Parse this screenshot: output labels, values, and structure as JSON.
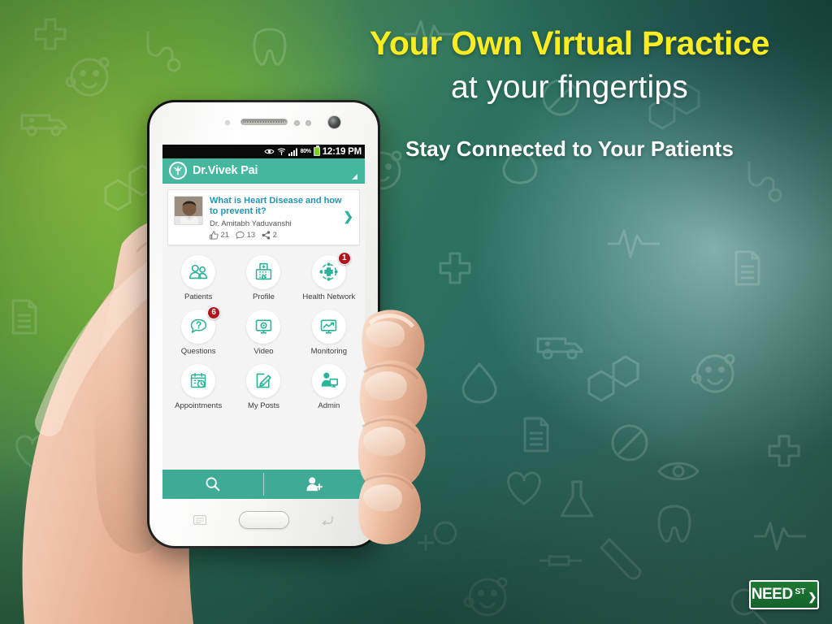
{
  "hero": {
    "line1": "Your Own Virtual Practice",
    "line2": "at your fingertips",
    "line3": "Stay Connected to Your Patients",
    "accent_yellow": "#fbed21",
    "accent_white": "#ffffff"
  },
  "phone": {
    "statusbar": {
      "eye_icon": "eye-icon",
      "wifi_icon": "wifi-icon",
      "signal_icon": "signal-bars-icon",
      "battery_percent": "80%",
      "battery_icon": "battery-icon",
      "time": "12:19 PM"
    },
    "appbar": {
      "logo_icon": "caduceus-logo-icon",
      "title": "Dr.Vivek Pai",
      "caret_icon": "dropdown-caret-icon",
      "color": "#45b79f"
    },
    "feed_card": {
      "thumb_icon": "doctor-avatar",
      "title": "What is Heart Disease and how to prevent it?",
      "author": "Dr. Amitabh Yaduvanshi",
      "likes": "21",
      "comments": "13",
      "shares": "2",
      "like_icon": "thumbs-up-icon",
      "comment_icon": "comment-bubble-icon",
      "share_icon": "share-icon",
      "chevron_icon": "chevron-right-icon",
      "title_color": "#2196b3"
    },
    "grid": [
      {
        "label": "Patients",
        "icon": "patients-icon",
        "badge": ""
      },
      {
        "label": "Profile",
        "icon": "hospital-icon",
        "badge": ""
      },
      {
        "label": "Health Network",
        "icon": "health-network-icon",
        "badge": "1"
      },
      {
        "label": "Questions",
        "icon": "question-bubble-icon",
        "badge": "6"
      },
      {
        "label": "Video",
        "icon": "video-monitor-icon",
        "badge": ""
      },
      {
        "label": "Monitoring",
        "icon": "monitoring-chart-icon",
        "badge": ""
      },
      {
        "label": "Appointments",
        "icon": "calendar-clock-icon",
        "badge": ""
      },
      {
        "label": "My Posts",
        "icon": "edit-note-icon",
        "badge": ""
      },
      {
        "label": "Admin",
        "icon": "admin-desk-icon",
        "badge": ""
      }
    ],
    "actionbar": {
      "search_icon": "search-icon",
      "add_person_icon": "add-person-icon",
      "color": "#3faa96"
    },
    "navbar": {
      "menu_icon": "menu-key-icon",
      "home_icon": "home-button",
      "back_icon": "back-key-icon"
    },
    "badge_color": "#b3141e",
    "icon_teal": "#2bb39a"
  },
  "logo": {
    "name": "NEED",
    "suffix": "ST",
    "arrow": "❯",
    "sign_color": "#1f7a35"
  }
}
